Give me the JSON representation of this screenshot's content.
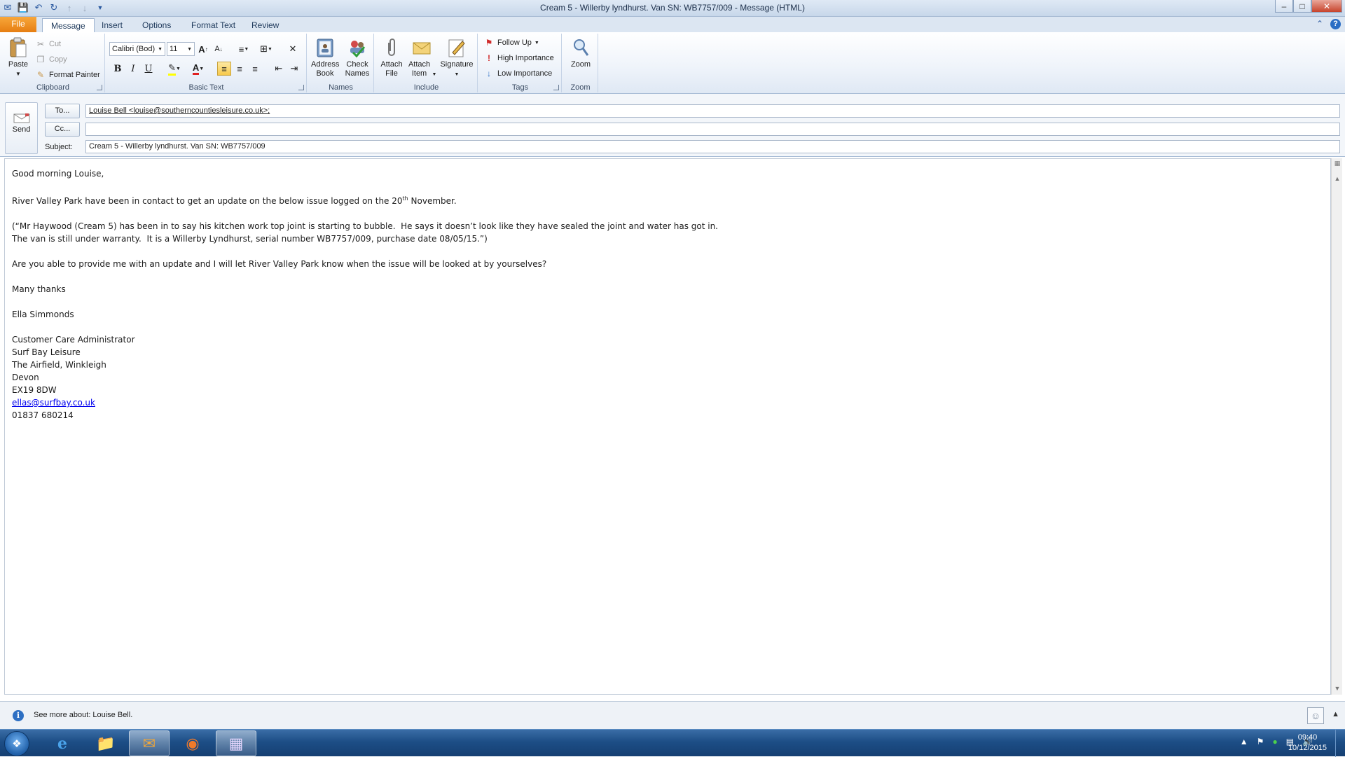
{
  "window": {
    "title": "Cream 5 - Willerby lyndhurst. Van SN: WB7757/009  -  Message (HTML)",
    "controls": [
      "–",
      "□",
      "✕"
    ]
  },
  "quick_access": [
    "save-icon",
    "undo-icon",
    "redo-icon",
    "up-icon",
    "down-icon",
    "customize-icon"
  ],
  "tabs": [
    {
      "label": "File"
    },
    {
      "label": "Message"
    },
    {
      "label": "Insert"
    },
    {
      "label": "Options"
    },
    {
      "label": "Format Text"
    },
    {
      "label": "Review"
    }
  ],
  "active_tab": "Message",
  "ribbon": {
    "clipboard": {
      "label": "Clipboard",
      "paste": "Paste",
      "cut": "Cut",
      "copy": "Copy",
      "format_painter": "Format Painter"
    },
    "basic_text": {
      "label": "Basic Text",
      "font_name": "Calibri (Bod)",
      "font_size": "11",
      "bold": "B",
      "italic": "I",
      "underline": "U",
      "font_color_letter": "A"
    },
    "names": {
      "label": "Names",
      "address_book": "Address Book",
      "check_names": "Check Names"
    },
    "include": {
      "label": "Include",
      "attach_file": "Attach File",
      "attach_item": "Attach Item",
      "signature": "Signature"
    },
    "tags": {
      "label": "Tags",
      "follow_up": "Follow Up",
      "high_importance": "High Importance",
      "low_importance": "Low Importance"
    },
    "zoom": {
      "label": "Zoom",
      "zoom": "Zoom"
    }
  },
  "header": {
    "send": "Send",
    "to_button": "To...",
    "cc_button": "Cc...",
    "subject_label": "Subject:",
    "to_value": "Louise Bell <louise@southerncountiesleisure.co.uk>;",
    "cc_value": "",
    "subject_value": "Cream 5 - Willerby lyndhurst. Van SN: WB7757/009"
  },
  "body": {
    "greeting": "Good morning Louise,",
    "para1_before": "River Valley Park have been in contact to get an update on the below issue logged on the 20",
    "para1_sup": "th",
    "para1_after": " November.",
    "para2_line1": "(“Mr Haywood (Cream 5) has been in to say his kitchen work top joint is starting to bubble.  He says it doesn’t look like they have sealed the joint and water has got in.",
    "para2_line2": "The van is still under warranty.  It is a Willerby Lyndhurst, serial number WB7757/009, purchase date 08/05/15.”)",
    "para3": "Are you able to provide me with an update and I will let River Valley Park know when the issue will be looked at by yourselves?",
    "closing": "Many thanks",
    "name": "Ella Simmonds",
    "signature": {
      "title": "Customer Care Administrator",
      "company": "Surf Bay Leisure",
      "address1": "The Airfield, Winkleigh",
      "address2": "Devon",
      "postcode": "EX19 8DW",
      "email": "ellas@surfbay.co.uk",
      "phone": "01837 680214"
    }
  },
  "people_pane": {
    "text": "See more about: Louise Bell."
  },
  "taskbar": {
    "time": "09:40",
    "date": "10/12/2015"
  },
  "colors": {
    "file_tab": "#e67e12",
    "accent": "#2a6dc4",
    "taskbar": "#1d4e86",
    "link": "#0000ee"
  }
}
